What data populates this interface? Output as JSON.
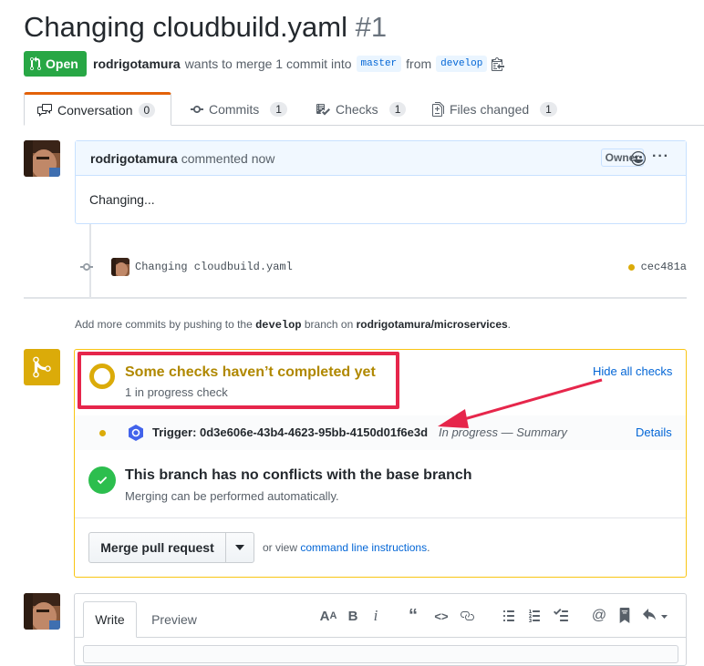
{
  "pr": {
    "title": "Changing cloudbuild.yaml",
    "number": "#1",
    "state": "Open",
    "author": "rodrigotamura",
    "merge_text": "wants to merge 1 commit into",
    "base_branch": "master",
    "from_text": "from",
    "head_branch": "develop"
  },
  "tabs": [
    {
      "label": "Conversation",
      "count": "0"
    },
    {
      "label": "Commits",
      "count": "1"
    },
    {
      "label": "Checks",
      "count": "1"
    },
    {
      "label": "Files changed",
      "count": "1"
    }
  ],
  "comment": {
    "author": "rodrigotamura",
    "action": "commented now",
    "badge": "Owner",
    "body": "Changing..."
  },
  "commit": {
    "message": "Changing cloudbuild.yaml",
    "sha": "cec481a"
  },
  "push_hint": {
    "prefix": "Add more commits by pushing to the",
    "branch": "develop",
    "middle": "branch on",
    "repo": "rodrigotamura/microservices",
    "suffix": "."
  },
  "checks": {
    "title": "Some checks haven’t completed yet",
    "subtitle": "1 in progress check",
    "hide_link": "Hide all checks",
    "item_name": "Trigger: 0d3e606e-43b4-4623-95bb-4150d01f6e3d",
    "item_status": "In progress — Summary",
    "details_link": "Details"
  },
  "conflicts": {
    "title": "This branch has no conflicts with the base branch",
    "subtitle": "Merging can be performed automatically."
  },
  "merge": {
    "button_label": "Merge pull request",
    "or_view": "or view",
    "cli_link": "command line instructions",
    "suffix": "."
  },
  "editor": {
    "write_tab": "Write",
    "preview_tab": "Preview"
  },
  "colors": {
    "open_green": "#28a745",
    "pending_yellow": "#dbab09",
    "success_green": "#2cbe4e",
    "link_blue": "#0366d6",
    "annotation_red": "#e6264b"
  }
}
